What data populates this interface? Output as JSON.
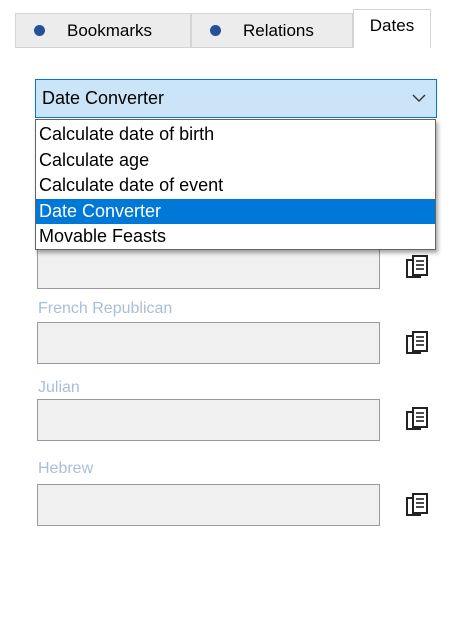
{
  "tabs": [
    {
      "label": "Bookmarks",
      "icon": "bullet-dot"
    },
    {
      "label": "Relations",
      "icon": "bullet-dot"
    },
    {
      "label": "Dates",
      "active": true
    }
  ],
  "combo": {
    "selected": "Date Converter",
    "icon": "chevron-down-icon"
  },
  "dropdown": {
    "items": [
      "Calculate date of birth",
      "Calculate age",
      "Calculate date of event",
      "Date Converter",
      "Movable Feasts"
    ],
    "selected": "Date Converter"
  },
  "fields": [
    {
      "label": "",
      "value": "",
      "copy_icon": "copy-icon"
    },
    {
      "label": "French Republican",
      "value": "",
      "copy_icon": "copy-icon"
    },
    {
      "label": "Julian",
      "value": "",
      "copy_icon": "copy-icon"
    },
    {
      "label": "Hebrew",
      "value": "",
      "copy_icon": "copy-icon"
    }
  ],
  "colors": {
    "accent": "#0078d7",
    "combo_bg": "#cce4f7",
    "label_disabled": "#a9bfd9",
    "tab_dot": "#24519a"
  }
}
